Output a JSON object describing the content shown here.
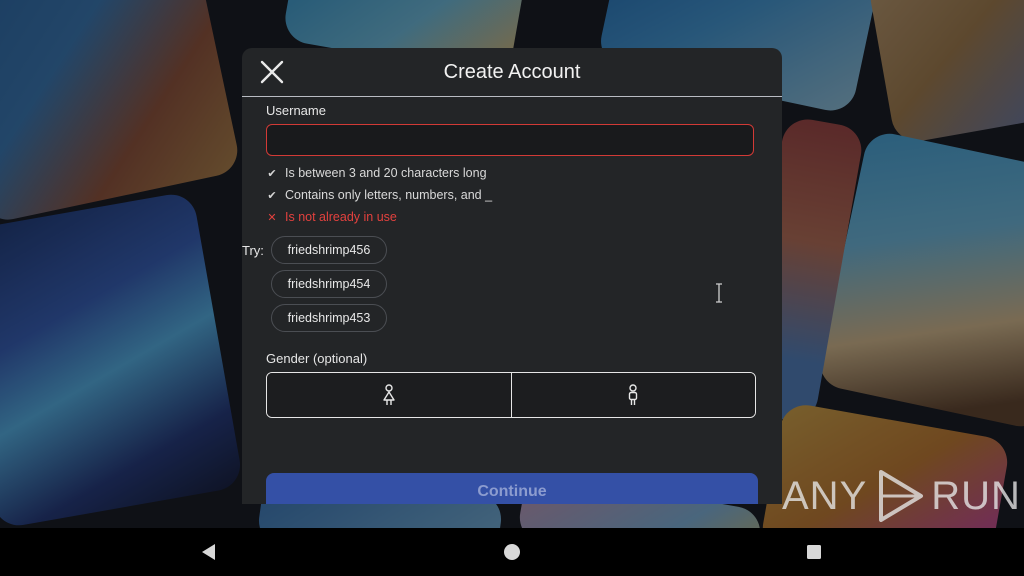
{
  "dialog": {
    "title": "Create Account",
    "close_icon": "close-icon"
  },
  "username": {
    "label": "Username",
    "value": "",
    "placeholder": "",
    "rules": [
      {
        "status": "pass",
        "icon": "check-icon",
        "text": "Is between 3 and 20 characters long"
      },
      {
        "status": "pass",
        "icon": "check-icon",
        "text": "Contains only letters, numbers, and _"
      },
      {
        "status": "fail",
        "icon": "cross-icon",
        "text": "Is not already in use"
      }
    ]
  },
  "suggestions": {
    "label": "Try:",
    "items": [
      "friedshrimp456",
      "friedshrimp454",
      "friedshrimp453"
    ]
  },
  "gender": {
    "label": "Gender (optional)",
    "options": [
      {
        "icon": "female-person-icon"
      },
      {
        "icon": "male-person-icon"
      }
    ]
  },
  "continue_label": "Continue",
  "watermark": {
    "left": "ANY",
    "right": "RUN"
  },
  "navbar": {
    "icons": [
      "back-triangle-icon",
      "home-circle-icon",
      "recents-square-icon"
    ]
  },
  "colors": {
    "dialog_bg": "#232527",
    "error": "#e2413e",
    "continue_bg": "#3450a6",
    "continue_text": "#8c9ccf"
  }
}
